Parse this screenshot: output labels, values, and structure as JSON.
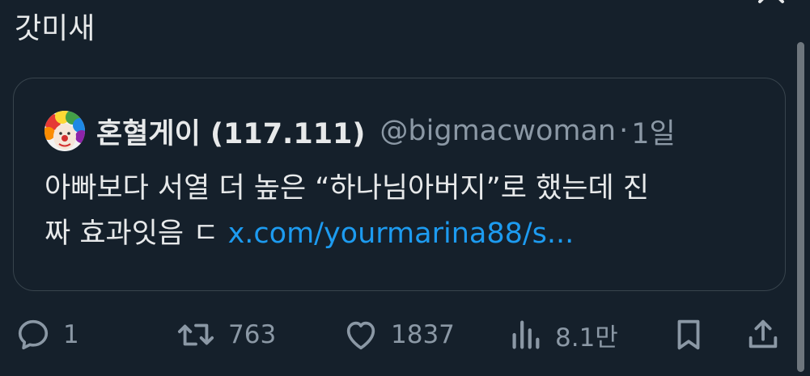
{
  "tweet": {
    "text": "갓미새"
  },
  "quote": {
    "name": "혼혈게이 (117.111)",
    "handle": "@bigmacwoman",
    "separator": "·",
    "time": "1일",
    "body_line1": "아빠보다 서열 더 높은 “하나님아버지”로 했는데 진",
    "body_line2_prefix": "짜 효과잇음 ㄷ ",
    "link": "x.com/yourmarina88/s..."
  },
  "actions": {
    "reply_count": "1",
    "retweet_count": "763",
    "like_count": "1837",
    "views_count": "8.1만"
  },
  "icons": {
    "reply": "reply-bubble-icon",
    "retweet": "retweet-icon",
    "like": "heart-icon",
    "views": "bar-chart-icon",
    "bookmark": "bookmark-icon",
    "share": "share-icon",
    "close": "close-icon"
  },
  "colors": {
    "background": "#15202b",
    "text": "#e7e9ea",
    "secondary": "#8b98a5",
    "link": "#1d9bf0",
    "border": "#38444d"
  }
}
